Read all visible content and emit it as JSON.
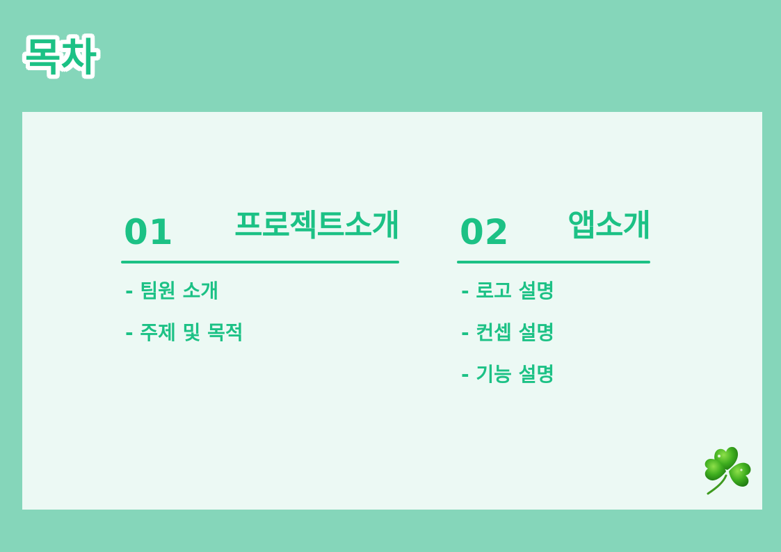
{
  "page": {
    "title": "목차"
  },
  "sections": [
    {
      "number": "01",
      "title": "프로젝트소개",
      "items": [
        "- 팀원 소개",
        "- 주제 및 목적"
      ]
    },
    {
      "number": "02",
      "title": "앱소개",
      "items": [
        "- 로고 설명",
        "- 컨셉 설명",
        "- 기능 설명"
      ]
    }
  ],
  "decoration": {
    "icon": "clover-icon"
  },
  "colors": {
    "background": "#85d6ba",
    "panel": "#ecf9f4",
    "accent": "#1cc185",
    "title_outline": "#ffffff"
  }
}
